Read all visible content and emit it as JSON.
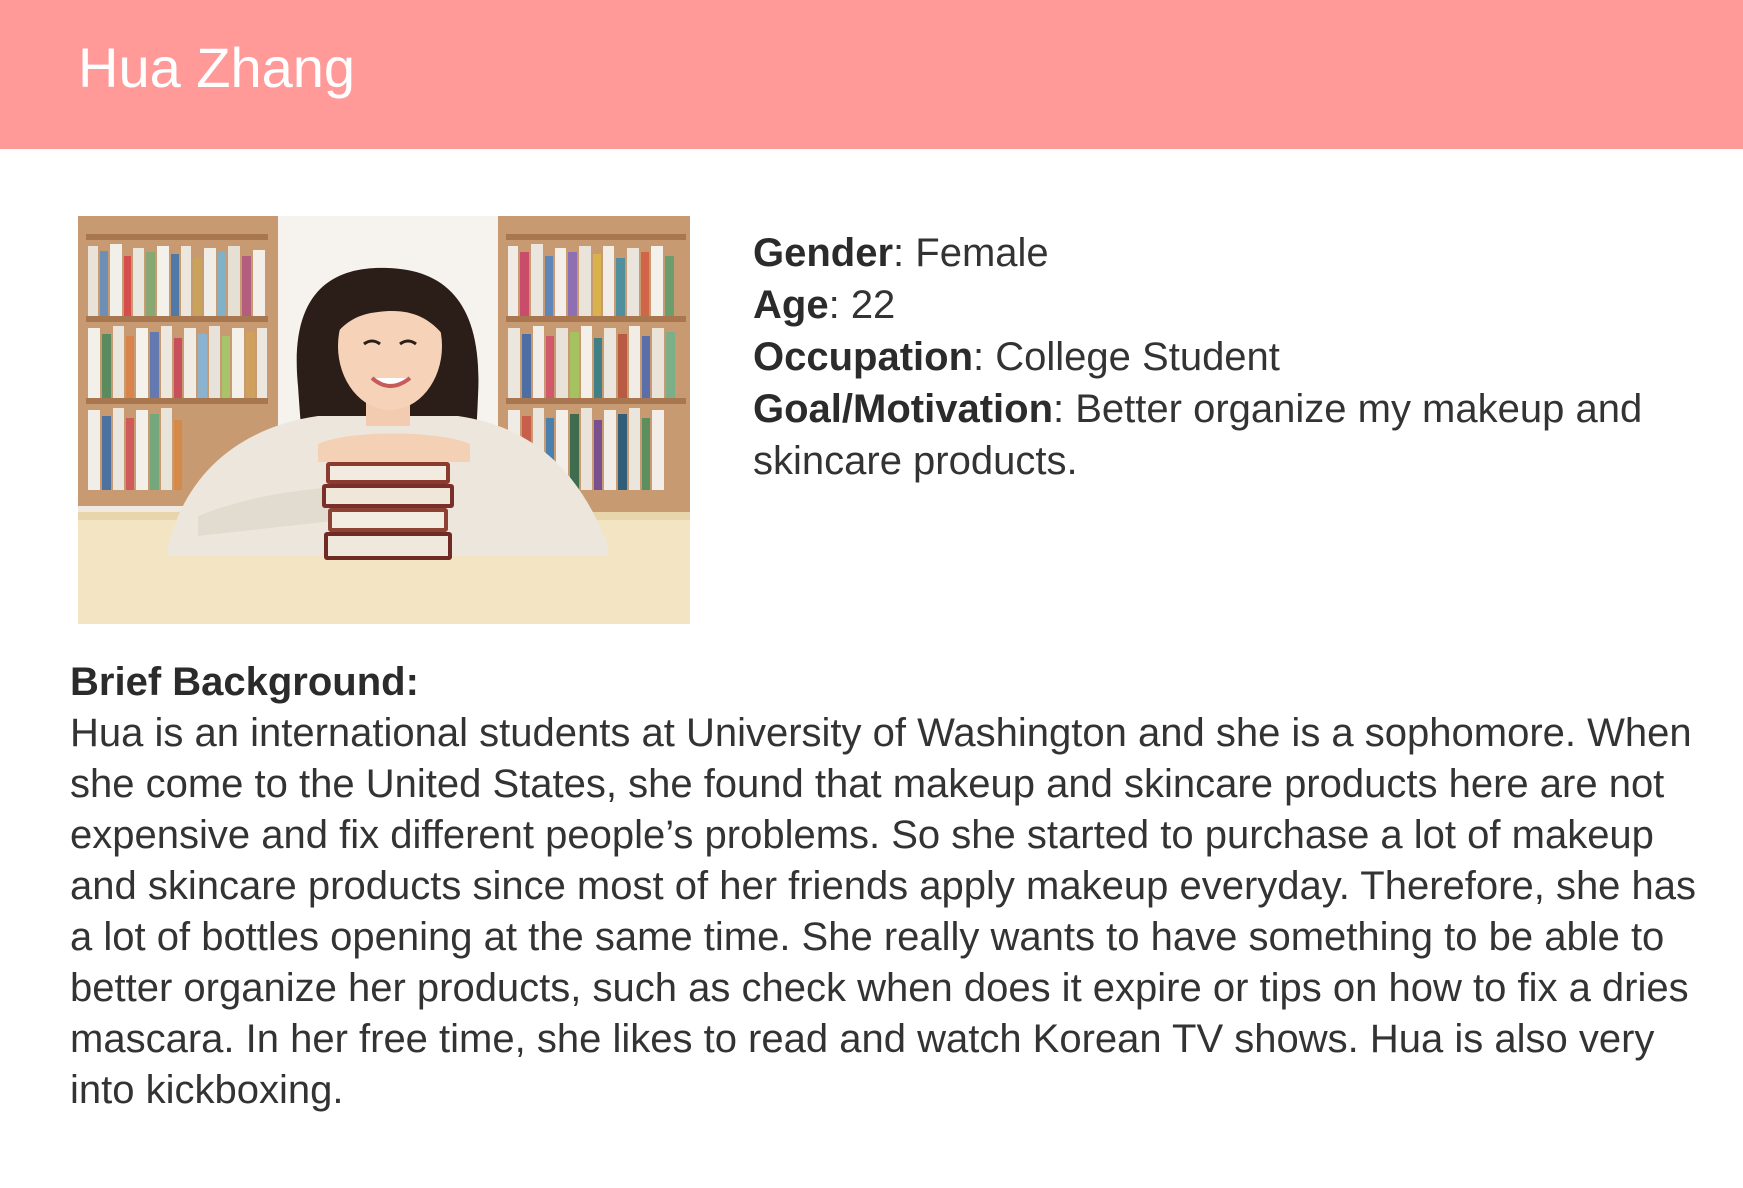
{
  "header": {
    "title": "Hua Zhang",
    "background_color": "#ff9a99"
  },
  "photo": {
    "icon": "persona-photo"
  },
  "details": {
    "gender_label": "Gender",
    "gender_value": "Female",
    "age_label": "Age",
    "age_value": "22",
    "occupation_label": "Occupation",
    "occupation_value": "College Student",
    "goal_label": "Goal/Motivation",
    "goal_value": "Better organize my makeup and skincare products."
  },
  "background": {
    "heading": "Brief Background:",
    "text": "Hua is an international students at University of Washington and she is a sophomore. When she come to the United States, she found that makeup and skincare products here are not expensive and fix different people’s problems. So she started to purchase a lot of makeup and skincare products since most of her friends apply makeup everyday. Therefore, she has a lot of bottles opening at the same time. She really wants to have something to be able to better organize her products, such as check when does it expire or tips on how to fix a dries mascara. In her free time, she likes to read and watch Korean TV shows. Hua is also very into kickboxing."
  }
}
